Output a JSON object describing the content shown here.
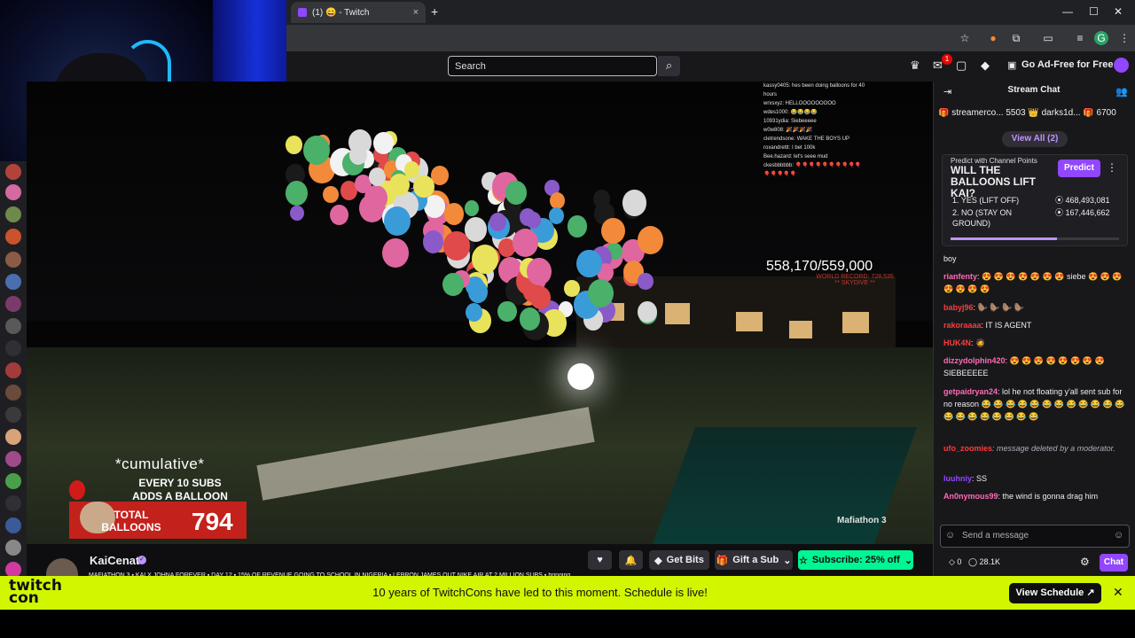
{
  "browser": {
    "tab_title": "(1) 😄 - Twitch",
    "new_tab": "+",
    "close_tab": "×",
    "minimize": "—",
    "maximize": "☐",
    "close_window": "✕"
  },
  "topnav": {
    "search_placeholder": "Search",
    "notification_count": "1",
    "ad_free_label": "Go Ad-Free for Free"
  },
  "video": {
    "cumulative": "*cumulative*",
    "every_line1": "EVERY 10 SUBS",
    "every_line2": "ADDS A BALLOON",
    "total_line1": "TOTAL",
    "total_line2": "BALLOONS",
    "total_count": "794",
    "counter": "558,170/559,000",
    "world_record": "WORLD RECORD: 728,535",
    "skydive": "** SKYDIVE **",
    "watermark": "Mafiathon 3",
    "overlay_chat": [
      "kassy0405: hes been doing balloons for 40",
      "hours",
      "wrxsxyz: HELLOOOOOOOOO",
      "wdes1000: 😂😂😂😂",
      "10931ydia: Siebeeeee",
      "w0w808: 🎉🎉🎉🎉",
      "cletrendsone: WAKE THE BOYS UP",
      "roxandrettt: I bet 100k",
      "Bee.hazard: let's seee mud",
      "ckesbbbbbb: 🎈🎈🎈🎈🎈🎈🎈🎈🎈🎈",
      "🎈🎈🎈🎈🎈"
    ]
  },
  "stream": {
    "channel": "KaiCenat",
    "verified": "✓",
    "get_bits": "Get Bits",
    "gift_sub": "Gift a Sub",
    "subscribe": "Subscribe: 25% off",
    "ticker": "MAFIATHON 3 ▪ KAI X JOHNA FOREVER ▪ DAY 12 ▪ 15% OF REVENUE GOING TO SCHOOL IN NIGERIA ▪ LEBRON JAMES OUT NIKE AIR AT 2 MILLION SUBS ▪ bringing"
  },
  "chat": {
    "header": "Stream Chat",
    "leaders": "🎁 streamerco... 5503 👑 darks1d... 🎁 6700",
    "view_all": "View All (2)",
    "prediction": {
      "subtitle": "Predict with Channel Points",
      "title": "WILL THE BALLOONS LIFT KAI?",
      "button": "Predict",
      "options": [
        {
          "label": "1.  YES (LIFT OFF)",
          "points": "468,493,081"
        },
        {
          "label": "2.  NO (STAY ON GROUND)",
          "points": "167,446,662"
        }
      ],
      "progress": 0.63
    },
    "messages": [
      {
        "user": "",
        "color": "#efeff1",
        "text": "boy"
      },
      {
        "user": "rianfenty",
        "color": "#ff6bb5",
        "text": ": 😍 😍 😍 😍 😍 😍 😍 siebe 😍 😍 😍 😍 😍 😍 😍"
      },
      {
        "user": "babyj96",
        "color": "#ff3b3b",
        "text": ": 🦫 🦫 🦫 🦫"
      },
      {
        "user": "rakoraaaa",
        "color": "#ff3b3b",
        "text": ": IT IS AGENT"
      },
      {
        "user": "HUK4N",
        "color": "#ff3b3b",
        "text": ": 🧔"
      },
      {
        "user": "dizzydolphin420",
        "color": "#ff6bb5",
        "text": ": 😍 😍 😍 😍 😍 😍 😍 😍 SIEBEEEEE"
      },
      {
        "user": "getpaidryan24",
        "color": "#ff6bb5",
        "text": ": lol he not floating y'all sent sub for no reason 😂 😂 😂 😂 😂 😂 😂 😂 😂 😂 😂 😂 😂 😂 😂 😂 😂 😂 😂 😂"
      },
      {
        "user": "ufo_zoomies",
        "color": "#ff3b3b",
        "text": ": message deleted by a moderator."
      },
      {
        "user": "luuhniy",
        "color": "#9147ff",
        "text": ": SS"
      },
      {
        "user": "An0nymous99",
        "color": "#ff6bb5",
        "text": ": the wind is gonna drag him"
      }
    ],
    "input_placeholder": "Send a message",
    "points": "0",
    "viewers": "28.1K",
    "chat_button": "Chat"
  },
  "banner": {
    "logo_line1": "twitch",
    "logo_line2": "con",
    "text": "10 years of TwitchCons have led to this moment. Schedule is live!",
    "button": "View Schedule ↗",
    "close": "✕"
  }
}
